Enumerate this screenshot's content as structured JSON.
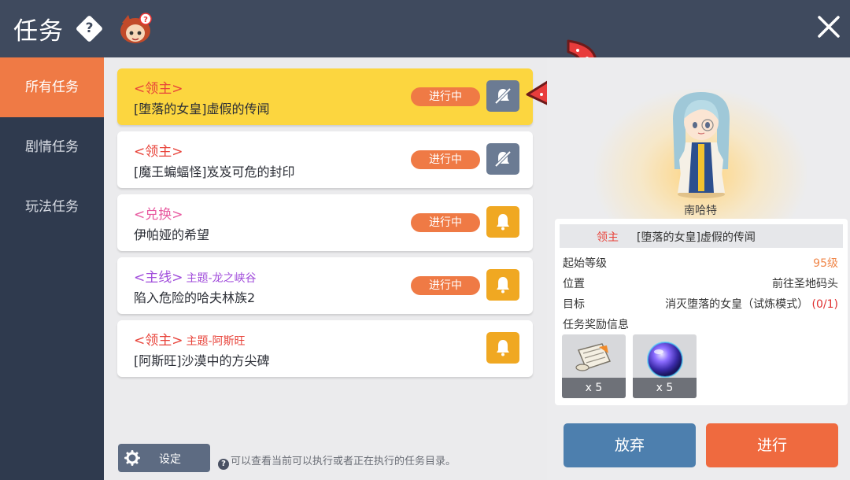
{
  "header": {
    "title": "任务",
    "help_glyph": "?",
    "close_glyph": "×"
  },
  "sidebar": {
    "items": [
      {
        "label": "所有任务",
        "active": true
      },
      {
        "label": "剧情任务",
        "active": false
      },
      {
        "label": "玩法任务",
        "active": false
      }
    ]
  },
  "quests": [
    {
      "type": "<领主>",
      "theme": "",
      "name": "[堕落的女皇]虚假的传闻",
      "status": "进行中",
      "alert": "off",
      "selected": true
    },
    {
      "type": "<领主>",
      "theme": "",
      "name": "[魔王蝙蝠怪]岌岌可危的封印",
      "status": "进行中",
      "alert": "off",
      "selected": false
    },
    {
      "type": "<兑换>",
      "theme": "",
      "name": "伊帕娅的希望",
      "status": "进行中",
      "alert": "on",
      "selected": false
    },
    {
      "type": "<主线>",
      "theme": "主题-龙之峡谷",
      "name": "陷入危险的哈夫林族2",
      "status": "进行中",
      "alert": "on",
      "selected": false
    },
    {
      "type": "<领主>",
      "theme": "主题-阿斯旺",
      "name": "[阿斯旺]沙漠中的方尖碑",
      "status": "",
      "alert": "on",
      "selected": false
    }
  ],
  "footer": {
    "settings_label": "设定",
    "help_glyph": "?",
    "help_text": "可以查看当前可以执行或者正在执行的任务目录。"
  },
  "detail": {
    "npc_name": "南哈特",
    "category": "领主",
    "quest_name": "[堕落的女皇]虚假的传闻",
    "start_level_label": "起始等级",
    "start_level": "95级",
    "location_label": "位置",
    "location": "前往圣地码头",
    "goal_label": "目标",
    "goal": "消灭堕落的女皇（试炼模式）",
    "goal_progress": "(0/1)",
    "reward_label": "任务奖励信息",
    "rewards": [
      {
        "icon": "scroll-icon",
        "count": "x 5"
      },
      {
        "icon": "purple-orb-icon",
        "count": "x 5"
      }
    ],
    "abandon_label": "放弃",
    "proceed_label": "进行"
  },
  "colors": {
    "header_bg": "#3f4a5e",
    "sidebar_bg": "#2f3a4e",
    "accent_orange": "#ef7a45",
    "selected_card": "#fcd63f",
    "bell_on": "#f0a822",
    "bell_off": "#6b7b93",
    "abandon_blue": "#4d7fae",
    "proceed_orange": "#ef6a3f"
  }
}
